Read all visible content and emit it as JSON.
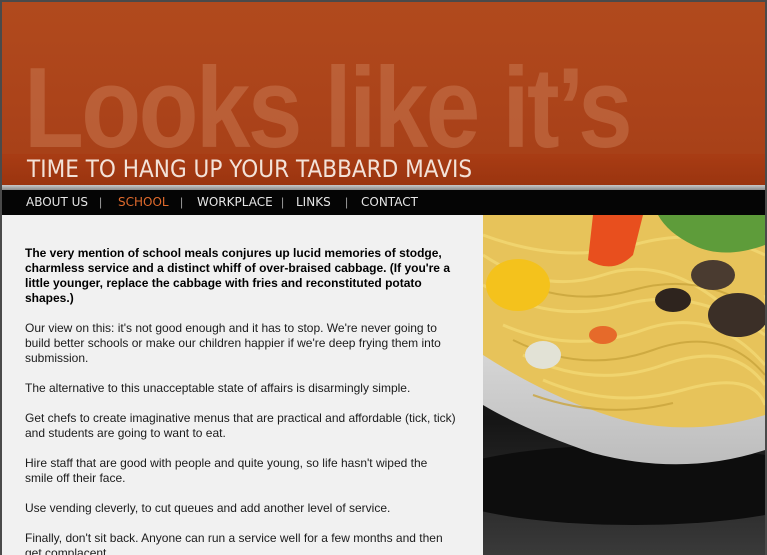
{
  "header": {
    "watermark": "Looks like it’s",
    "tagline": "TIME TO HANG UP YOUR TABBARD MAVIS"
  },
  "nav": {
    "items": [
      {
        "label": "ABOUT US",
        "active": false
      },
      {
        "label": "SCHOOL",
        "active": true
      },
      {
        "label": "WORKPLACE",
        "active": false
      },
      {
        "label": "LINKS",
        "active": false
      },
      {
        "label": "CONTACT",
        "active": false
      }
    ],
    "separator": "|"
  },
  "article": {
    "lead": "The very mention of school meals conjures up lucid memories of stodge, charmless service and a distinct whiff of over-braised cabbage. (If you're a little younger, replace the cabbage with fries and reconstituted potato shapes.)",
    "paragraphs": [
      "Our view on this: it's not good enough and it has to stop. We're never going to build better schools or make our children happier if we're deep frying them into submission.",
      "The alternative to this unacceptable state of affairs is disarmingly simple.",
      "Get chefs to create imaginative menus that are practical and affordable (tick, tick) and students are going to want to eat.",
      "Hire staff that are good with people and quite young, so life hasn't wiped the smile off their face.",
      "Use vending cleverly, to cut queues and add another level of service.",
      "Finally, don't sit back. Anyone can run a service well for a few months and then get complacent."
    ]
  },
  "colors": {
    "header": "#ab431a",
    "nav_background": "#050505",
    "nav_active": "#e06a2c",
    "content_background": "#f1f1f1"
  }
}
